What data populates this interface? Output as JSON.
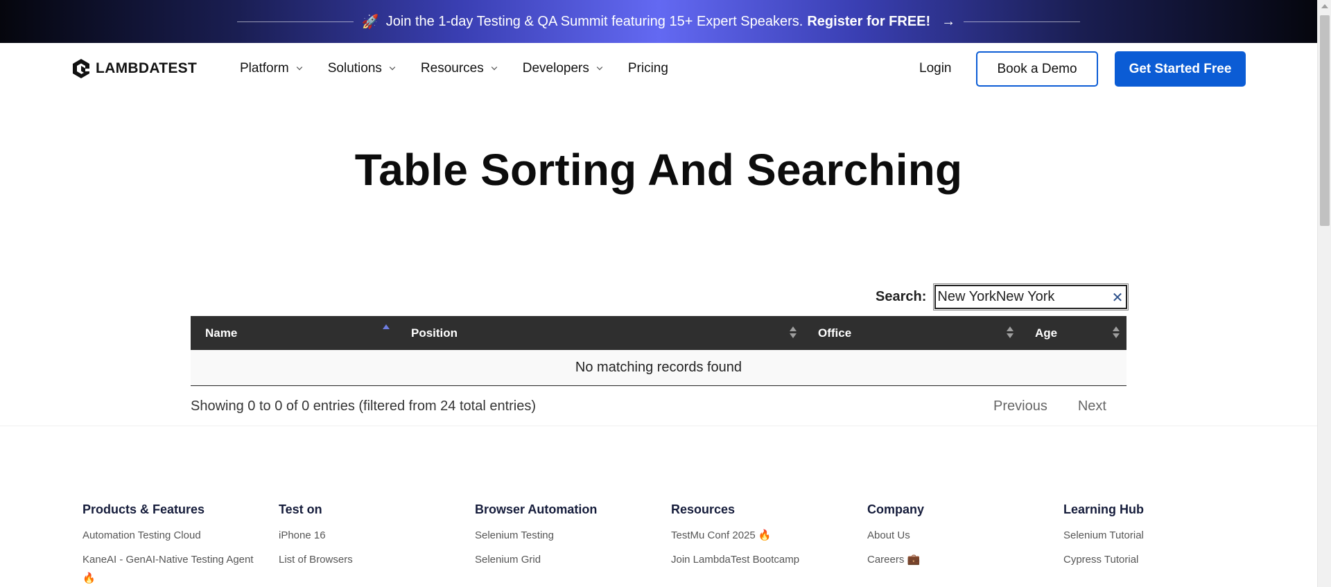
{
  "announcement": {
    "rocket": "🚀",
    "text": "Join the 1-day Testing & QA Summit featuring 15+ Expert Speakers.",
    "cta": "Register for FREE!",
    "arrow": "→"
  },
  "nav": {
    "logo_text": "LAMBDATEST",
    "items": [
      {
        "label": "Platform"
      },
      {
        "label": "Solutions"
      },
      {
        "label": "Resources"
      },
      {
        "label": "Developers"
      },
      {
        "label": "Pricing"
      }
    ],
    "login": "Login",
    "book_demo": "Book a Demo",
    "get_started": "Get Started Free"
  },
  "page": {
    "title": "Table Sorting And Searching"
  },
  "search": {
    "label": "Search:",
    "value": "New YorkNew York",
    "clear_glyph": "✕"
  },
  "table": {
    "columns": [
      "Name",
      "Position",
      "Office",
      "Age"
    ],
    "empty_message": "No matching records found",
    "info": "Showing 0 to 0 of 0 entries (filtered from 24 total entries)",
    "previous": "Previous",
    "next": "Next"
  },
  "footer": {
    "columns": [
      {
        "heading": "Products & Features",
        "links": [
          "Automation Testing Cloud",
          "KaneAI - GenAI-Native Testing Agent 🔥"
        ]
      },
      {
        "heading": "Test on",
        "links": [
          "iPhone 16",
          "List of Browsers"
        ]
      },
      {
        "heading": "Browser Automation",
        "links": [
          "Selenium Testing",
          "Selenium Grid"
        ]
      },
      {
        "heading": "Resources",
        "links": [
          "TestMu Conf 2025 🔥",
          "Join LambdaTest Bootcamp"
        ]
      },
      {
        "heading": "Company",
        "links": [
          "About Us",
          "Careers 💼"
        ]
      },
      {
        "heading": "Learning Hub",
        "links": [
          "Selenium Tutorial",
          "Cypress Tutorial"
        ]
      }
    ]
  },
  "colors": {
    "brand_blue": "#0b5cd5",
    "table_header": "#2f2f2f",
    "footer_heading": "#151c3b"
  }
}
